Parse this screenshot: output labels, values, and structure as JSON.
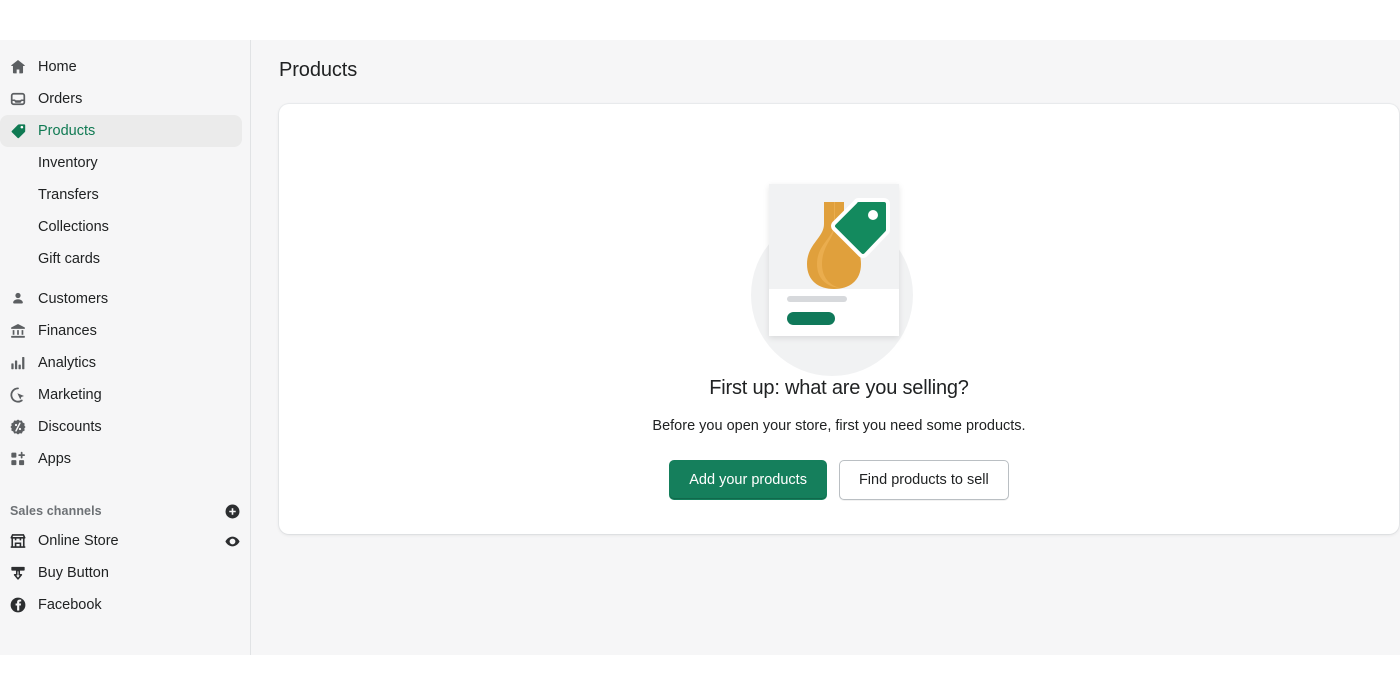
{
  "header": {
    "title": "Products"
  },
  "sidebar": {
    "nav": [
      {
        "label": "Home",
        "icon": "home-icon",
        "active": false
      },
      {
        "label": "Orders",
        "icon": "orders-inbox-icon",
        "active": false
      },
      {
        "label": "Products",
        "icon": "product-tag-icon",
        "active": true
      }
    ],
    "sub_items": [
      {
        "label": "Inventory"
      },
      {
        "label": "Transfers"
      },
      {
        "label": "Collections"
      },
      {
        "label": "Gift cards"
      }
    ],
    "nav2": [
      {
        "label": "Customers",
        "icon": "customer-person-icon"
      },
      {
        "label": "Finances",
        "icon": "finances-bank-icon"
      },
      {
        "label": "Analytics",
        "icon": "analytics-bars-icon"
      },
      {
        "label": "Marketing",
        "icon": "marketing-target-icon"
      },
      {
        "label": "Discounts",
        "icon": "discount-percent-icon"
      },
      {
        "label": "Apps",
        "icon": "apps-grid-plus-icon"
      }
    ],
    "sales_channels": {
      "title": "Sales channels",
      "add_icon": "circle-plus-icon",
      "items": [
        {
          "label": "Online Store",
          "icon": "storefront-icon",
          "trailing_icon": "eye-view-icon"
        },
        {
          "label": "Buy Button",
          "icon": "buy-button-icon",
          "trailing_icon": ""
        },
        {
          "label": "Facebook",
          "icon": "facebook-icon",
          "trailing_icon": ""
        }
      ]
    }
  },
  "empty_state": {
    "headline": "First up: what are you selling?",
    "subtext": "Before you open your store, first you need some products.",
    "primary_button": "Add your products",
    "secondary_button": "Find products to sell",
    "illustration": {
      "name": "product-card-vase-illustration",
      "vase_color": "#e0a03c",
      "vase_shade": "#eaad4e",
      "tag_color": "#138a5e",
      "pill_color": "#10795a",
      "backdrop_color": "#f1f2f3"
    }
  },
  "colors": {
    "brand_green": "#157f5c",
    "active_text": "#107a53",
    "sidebar_bg": "#f6f6f7",
    "card_bg": "#ffffff",
    "text": "#202223",
    "muted_text": "#6d7175"
  }
}
